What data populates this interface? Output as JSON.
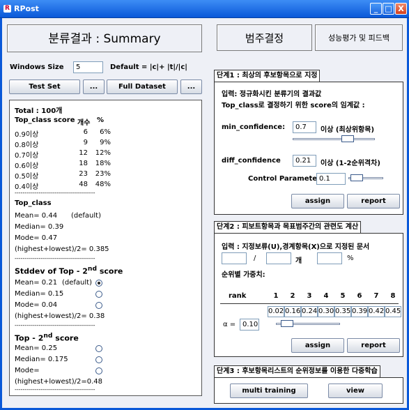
{
  "window": {
    "title": "RPost",
    "minimize": "_",
    "maximize": "□",
    "close": "X",
    "app_icon": "R"
  },
  "tabs": {
    "left": "분류결과 : Summary",
    "mid": "범주결정",
    "right": "성능평가 및 피드백"
  },
  "windows": {
    "label": "Windows Size",
    "value": "5",
    "default_label": "Default = |c|+ |t|/|c|"
  },
  "buttons": {
    "test_set": "Test Set",
    "dots1": "...",
    "full_dataset": "Full Dataset",
    "dots2": "..."
  },
  "summary": {
    "total": "Total : 100개",
    "header": {
      "score": "Top_class score",
      "count": "개수",
      "pct": "%"
    },
    "rows": [
      {
        "label": "0.9이상",
        "count": "6",
        "pct": "6%"
      },
      {
        "label": "0.8이상",
        "count": "9",
        "pct": "9%"
      },
      {
        "label": "0.7이상",
        "count": "12",
        "pct": "12%"
      },
      {
        "label": "0.6이상",
        "count": "18",
        "pct": "18%"
      },
      {
        "label": "0.5이상",
        "count": "23",
        "pct": "23%"
      },
      {
        "label": "0.4이상",
        "count": "48",
        "pct": "48%"
      }
    ],
    "divider": "----------------------------------------",
    "top_class": {
      "title": "Top_class",
      "mean": "Mean= 0.44",
      "mean_note": "(default)",
      "median": "Median= 0.39",
      "mode": "Mode= 0.47",
      "hl": "(highest+lowest)/2= 0.385"
    },
    "stddev": {
      "title_a": "Stddev of Top - 2",
      "title_sup": "nd",
      "title_b": "score",
      "mean": "Mean= 0.21",
      "mean_note": "(default)",
      "median": "Median= 0.15",
      "mode": "Mode= 0.04",
      "hl": "(highest+lowest)/2= 0.38"
    },
    "top2": {
      "title_a": "Top - 2",
      "title_sup": "nd",
      "title_b": "score",
      "mean": "Mean= 0.25",
      "median": "Median= 0.175",
      "mode": "Mode=",
      "hl": "(highest+lowest)/2=0.48"
    }
  },
  "step1": {
    "title": "단계1 : 최상의 후보항목으로 지정",
    "input_label": "입력: 정규화시킨 분류기의 결과값",
    "desc": "Top_class로 결정하기 위한 score의 임계값 :",
    "min_conf_label": "min_confidence:",
    "min_conf_value": "0.7",
    "min_conf_note": "이상 (최상위항목)",
    "min_conf_level": 0.7,
    "diff_conf_label": "diff_confidence",
    "diff_conf_value": "0.21",
    "diff_conf_note": "이상 (1-2순위격차)",
    "alpha_label": "Control Parameter α",
    "alpha_value": "0.1",
    "alpha_level": 0.1,
    "assign": "assign",
    "report": "report"
  },
  "step2": {
    "title": "단계2 : 피보트항목과 목표범주간의 관련도 계산",
    "input_label": "입력 : 지정보류(U),경계항목(X)으로 지정된 문서",
    "slash": "/",
    "unit_count": "개",
    "unit_pct": "%",
    "weights_label": "순위별 가중치:",
    "rank_label": "rank",
    "ranks": [
      "1",
      "2",
      "3",
      "4",
      "5",
      "6",
      "7",
      "8"
    ],
    "weights": [
      "0.02",
      "0.16",
      "0.24",
      "0.30",
      "0.35",
      "0.39",
      "0.42",
      "0.45"
    ],
    "alpha_label": "α =",
    "alpha_value": "0.10",
    "alpha_level": 0.1,
    "assign": "assign",
    "report": "report"
  },
  "step3": {
    "title": "단계3 : 후보항목리스트의 순위정보를 이용한 다중학습",
    "multi": "multi training",
    "view": "view"
  },
  "colors": {
    "titlebar": "#0a58d8",
    "client_bg": "#eef0f6"
  }
}
